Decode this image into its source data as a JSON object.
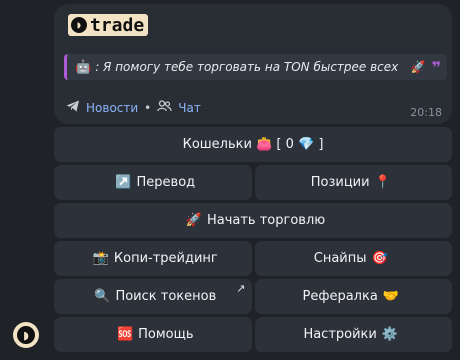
{
  "message": {
    "logo_text": "trade",
    "quote_icon": "🤖",
    "quote_text": ": Я помогу тебе торговать на TON быстрее всех",
    "quote_rocket": "🚀",
    "quote_mark": "❞",
    "link_news": "Новости",
    "link_separator": "•",
    "link_chat": "Чат",
    "time": "20:18"
  },
  "keyboard": {
    "wallets": "Кошельки 👛 [ 0 💎 ]",
    "transfer_emoji": "↗️",
    "transfer": "Перевод",
    "positions": "Позиции",
    "positions_emoji": "📍",
    "start_emoji": "🚀",
    "start_trading": "Начать торговлю",
    "copy_emoji": "📸",
    "copy_trading": "Копи-трейдинг",
    "snipes": "Снайпы",
    "snipes_emoji": "🎯",
    "search_emoji": "🔍",
    "search_tokens": "Поиск токенов",
    "search_corner": "↗",
    "referral": "Рефералка",
    "referral_emoji": "🤝",
    "help_emoji": "🆘",
    "help": "Помощь",
    "settings": "Настройки",
    "settings_emoji": "⚙️"
  },
  "colors": {
    "background": "#1f2227",
    "bubble": "#292e35",
    "button": "#2d323a",
    "link": "#8ab4f8",
    "quote_accent": "#b05bd6"
  }
}
